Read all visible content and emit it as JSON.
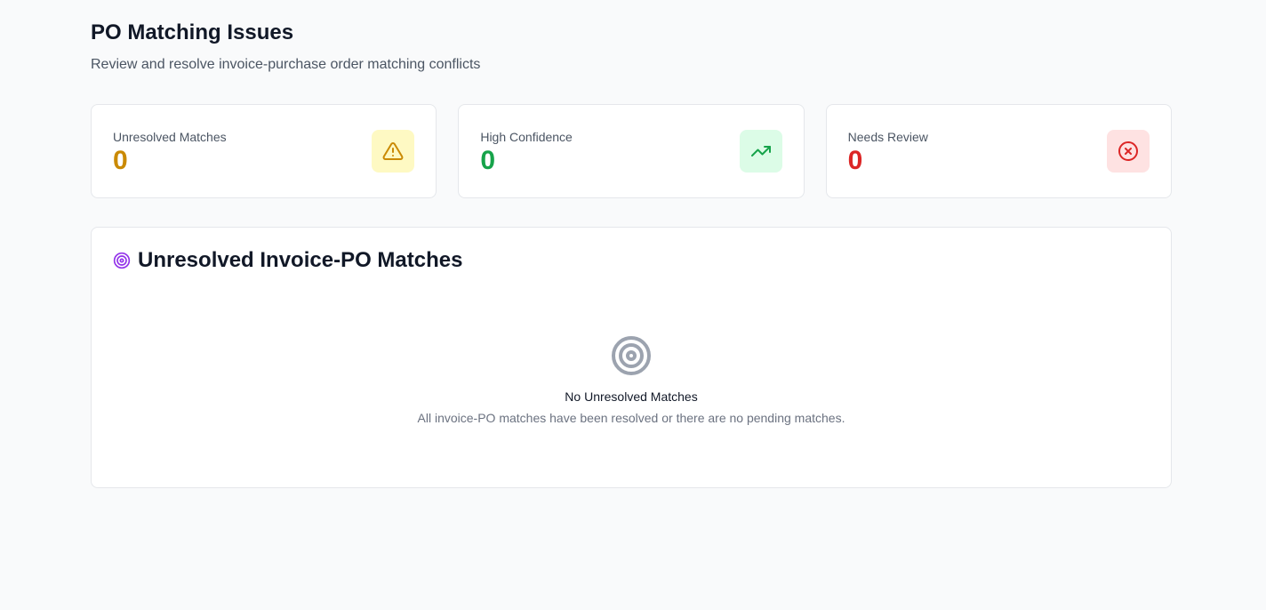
{
  "header": {
    "title": "PO Matching Issues",
    "subtitle": "Review and resolve invoice-purchase order matching conflicts"
  },
  "stats": [
    {
      "label": "Unresolved Matches",
      "value": "0",
      "icon": "warning-triangle-icon",
      "color": "#ca8a04",
      "bg": "#fef9c3"
    },
    {
      "label": "High Confidence",
      "value": "0",
      "icon": "trending-up-icon",
      "color": "#16a34a",
      "bg": "#dcfce7"
    },
    {
      "label": "Needs Review",
      "value": "0",
      "icon": "x-circle-icon",
      "color": "#dc2626",
      "bg": "#fee2e2"
    }
  ],
  "panel": {
    "title": "Unresolved Invoice-PO Matches",
    "icon": "target-icon",
    "icon_color": "#9333ea",
    "empty_title": "No Unresolved Matches",
    "empty_description": "All invoice-PO matches have been resolved or there are no pending matches.",
    "empty_icon": "target-icon"
  }
}
